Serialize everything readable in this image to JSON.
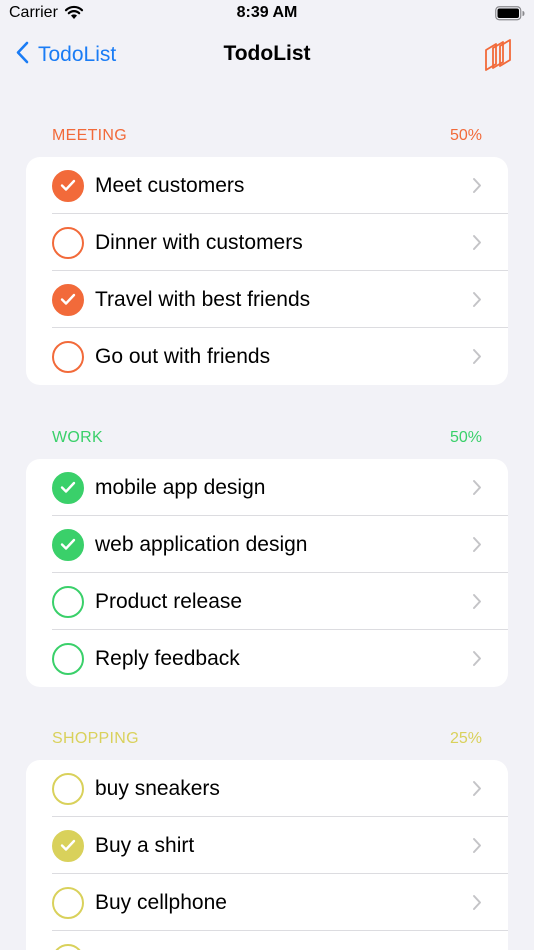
{
  "status_bar": {
    "carrier": "Carrier",
    "time": "8:39 AM"
  },
  "nav": {
    "back_label": "TodoList",
    "title": "TodoList",
    "accent_color": "#1a7cf5",
    "action_color": "#f26a3a"
  },
  "sections": [
    {
      "title": "MEETING",
      "percent": "50%",
      "color": "#f26a3a",
      "items": [
        {
          "label": "Meet customers",
          "done": true
        },
        {
          "label": "Dinner with customers",
          "done": false
        },
        {
          "label": "Travel with best friends",
          "done": true
        },
        {
          "label": "Go out with friends",
          "done": false
        }
      ]
    },
    {
      "title": "WORK",
      "percent": "50%",
      "color": "#3ad06a",
      "items": [
        {
          "label": "mobile app design",
          "done": true
        },
        {
          "label": "web application design",
          "done": true
        },
        {
          "label": "Product release",
          "done": false
        },
        {
          "label": "Reply feedback",
          "done": false
        }
      ]
    },
    {
      "title": "SHOPPING",
      "percent": "25%",
      "color": "#d9d15b",
      "items": [
        {
          "label": "buy sneakers",
          "done": false
        },
        {
          "label": "Buy a shirt",
          "done": true
        },
        {
          "label": "Buy cellphone",
          "done": false
        },
        {
          "label": "",
          "done": false
        }
      ]
    }
  ]
}
